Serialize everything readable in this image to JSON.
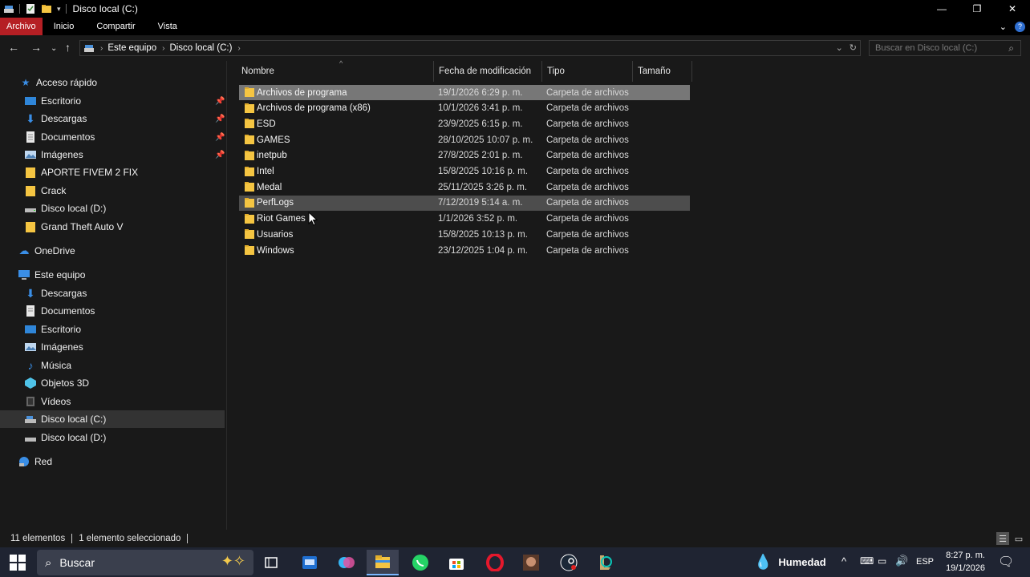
{
  "window": {
    "title": "Disco local (C:)",
    "controls": {
      "minimize": "—",
      "maximize": "❐",
      "close": "✕"
    }
  },
  "ribbon": {
    "tabs": [
      "Archivo",
      "Inicio",
      "Compartir",
      "Vista"
    ],
    "active_tab": "Archivo",
    "active_color": "#b51f24"
  },
  "address": {
    "segments": [
      "Este equipo",
      "Disco local (C:)"
    ],
    "search_placeholder": "Buscar en Disco local (C:)"
  },
  "sidebar": {
    "quick_access": "Acceso rápido",
    "pinned": [
      "Escritorio",
      "Descargas",
      "Documentos",
      "Imágenes"
    ],
    "recent": [
      "APORTE FIVEM 2 FIX",
      "Crack",
      "Disco local (D:)",
      "Grand Theft Auto V"
    ],
    "onedrive": "OneDrive",
    "this_pc": "Este equipo",
    "pc_items": [
      "Descargas",
      "Documentos",
      "Escritorio",
      "Imágenes",
      "Música",
      "Objetos 3D",
      "Vídeos",
      "Disco local (C:)",
      "Disco local (D:)"
    ],
    "network": "Red"
  },
  "columns": [
    "Nombre",
    "Fecha de modificación",
    "Tipo",
    "Tamaño"
  ],
  "files": [
    {
      "name": "Archivos de programa",
      "date": "19/1/2026 6:29 p. m.",
      "type": "Carpeta de archivos",
      "state": "selected"
    },
    {
      "name": "Archivos de programa (x86)",
      "date": "10/1/2026 3:41 p. m.",
      "type": "Carpeta de archivos",
      "state": ""
    },
    {
      "name": "ESD",
      "date": "23/9/2025 6:15 p. m.",
      "type": "Carpeta de archivos",
      "state": ""
    },
    {
      "name": "GAMES",
      "date": "28/10/2025 10:07 p. m.",
      "type": "Carpeta de archivos",
      "state": ""
    },
    {
      "name": "inetpub",
      "date": "27/8/2025 2:01 p. m.",
      "type": "Carpeta de archivos",
      "state": ""
    },
    {
      "name": "Intel",
      "date": "15/8/2025 10:16 p. m.",
      "type": "Carpeta de archivos",
      "state": ""
    },
    {
      "name": "Medal",
      "date": "25/11/2025 3:26 p. m.",
      "type": "Carpeta de archivos",
      "state": ""
    },
    {
      "name": "PerfLogs",
      "date": "7/12/2019 5:14 a. m.",
      "type": "Carpeta de archivos",
      "state": "hover"
    },
    {
      "name": "Riot Games",
      "date": "1/1/2026 3:52 p. m.",
      "type": "Carpeta de archivos",
      "state": ""
    },
    {
      "name": "Usuarios",
      "date": "15/8/2025 10:13 p. m.",
      "type": "Carpeta de archivos",
      "state": ""
    },
    {
      "name": "Windows",
      "date": "23/12/2025 1:04 p. m.",
      "type": "Carpeta de archivos",
      "state": ""
    }
  ],
  "status": {
    "count": "11 elementos",
    "selection": "1 elemento seleccionado"
  },
  "taskbar": {
    "search_label": "Buscar",
    "weather": "Humedad",
    "language": "ESP",
    "time": "8:27 p. m.",
    "date": "19/1/2026",
    "apps": [
      "task-view",
      "outlook",
      "copilot",
      "file-explorer",
      "whatsapp",
      "store",
      "opera",
      "game",
      "steam-like",
      "league"
    ]
  }
}
